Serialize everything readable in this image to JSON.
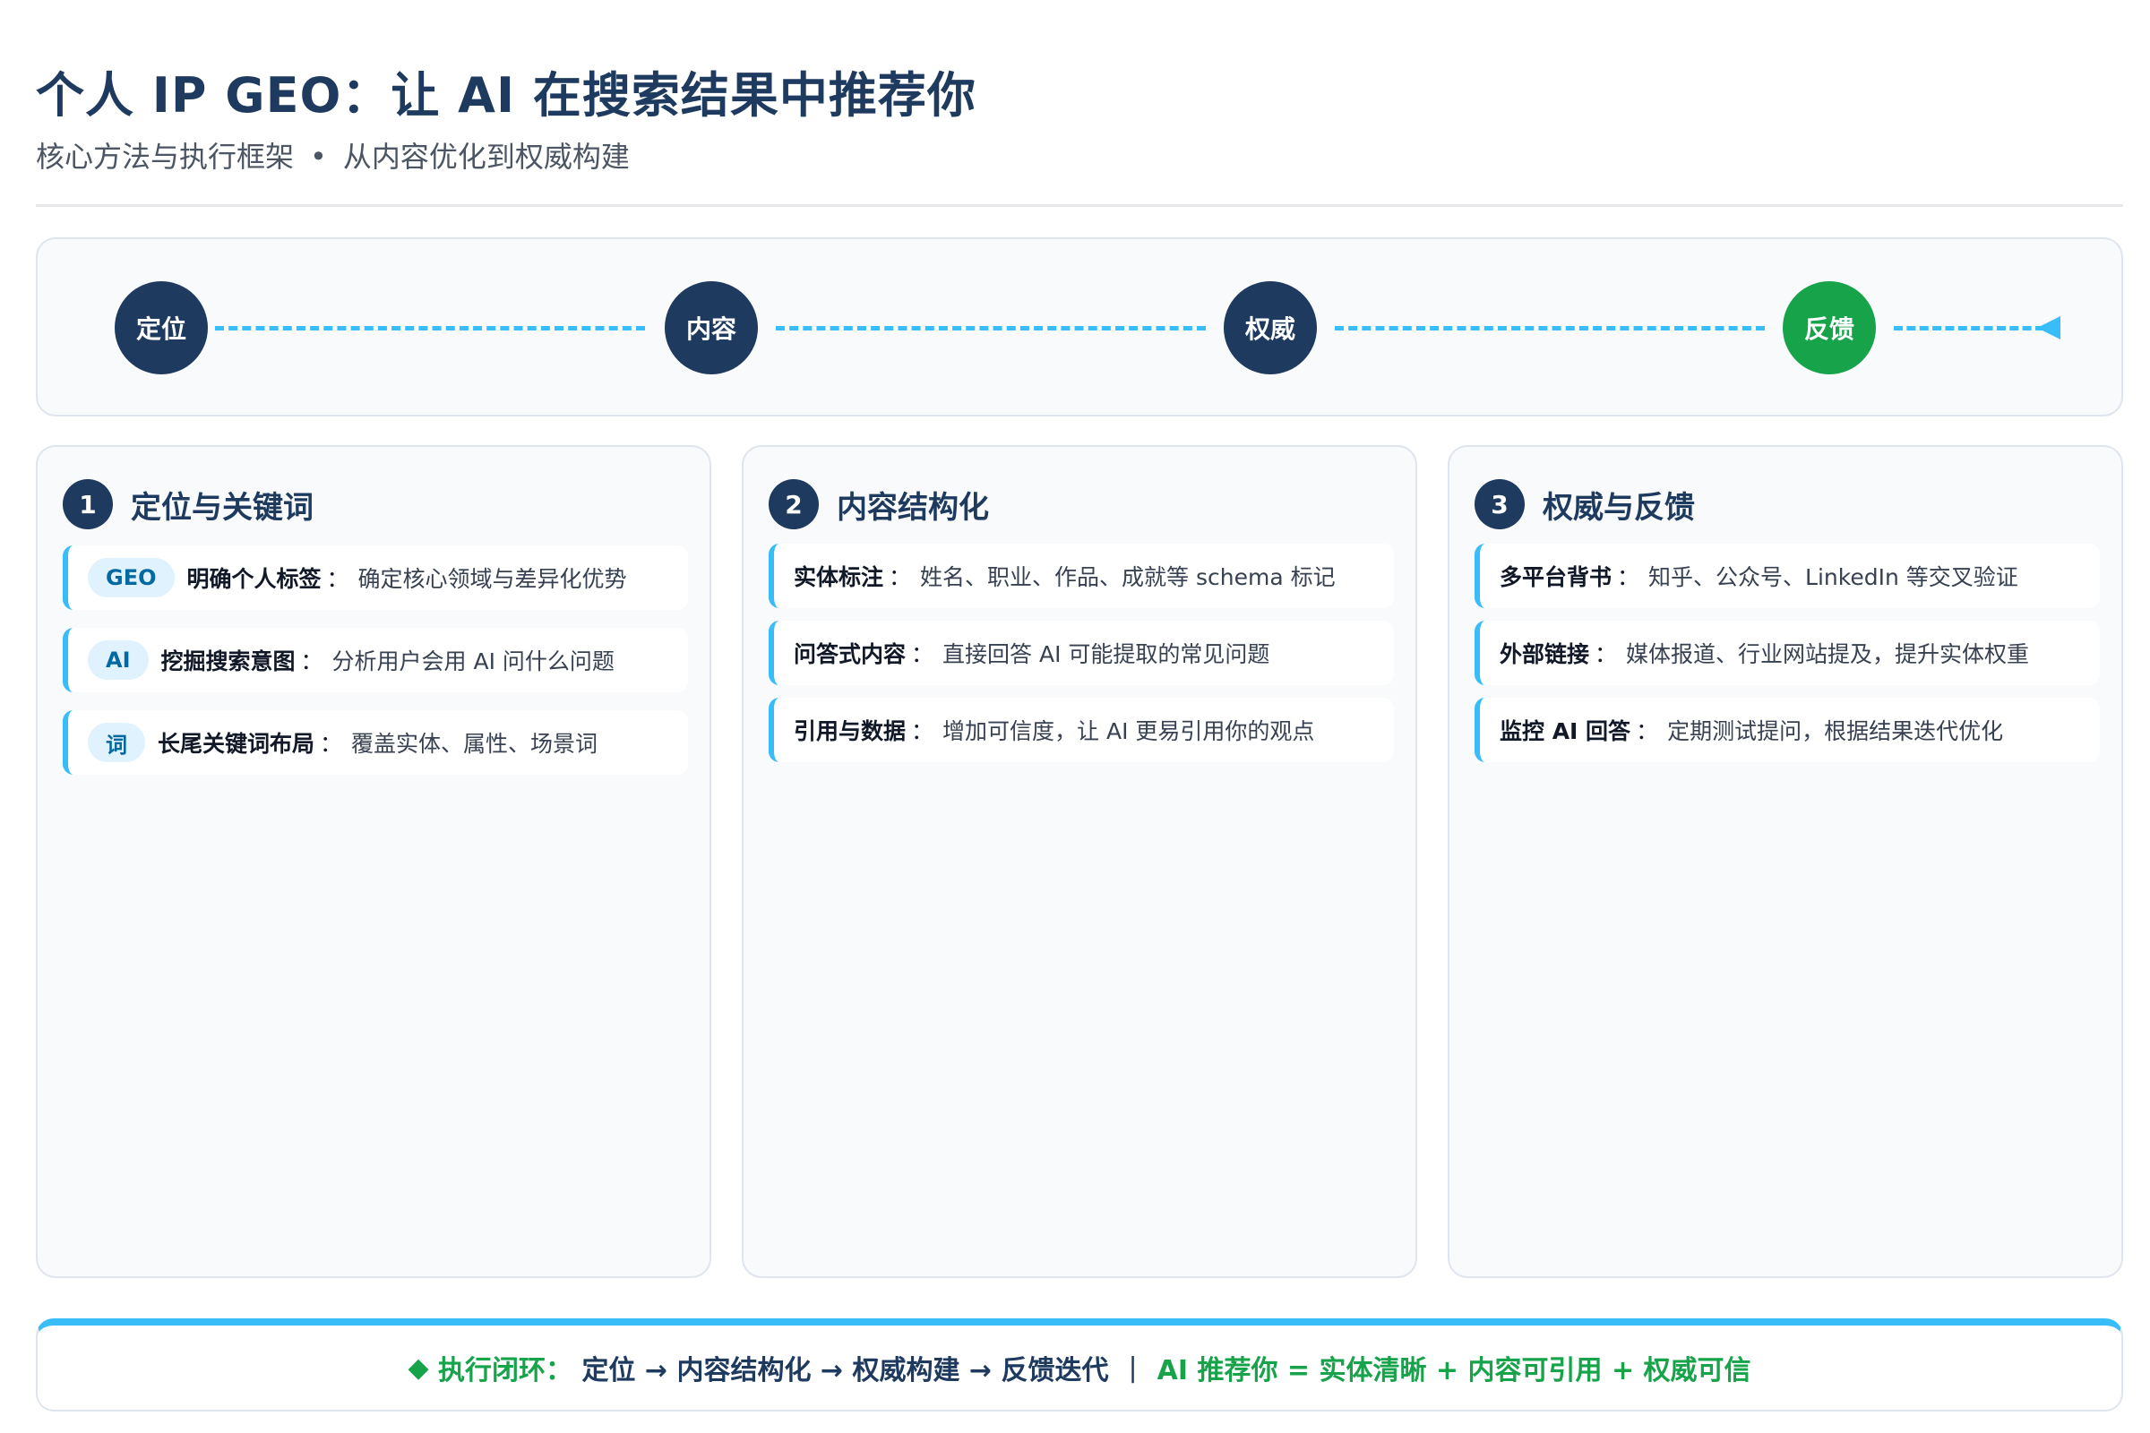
{
  "header": {
    "title": "个人 IP GEO：让 AI 在搜索结果中推荐你",
    "subtitle_left": "核心方法与执行框架",
    "subtitle_dot": "•",
    "subtitle_right": "从内容优化到权威构建"
  },
  "flow": {
    "steps": [
      "定位",
      "内容",
      "权威",
      "反馈"
    ],
    "colors": {
      "step": "#1e3a5f",
      "final": "#16a34a",
      "connector": "#38bdf8"
    }
  },
  "columns": [
    {
      "number": "1",
      "title": "定位与关键词",
      "items": [
        {
          "tag": "GEO",
          "label": "明确个人标签",
          "sep": "：",
          "desc": "确定核心领域与差异化优势"
        },
        {
          "tag": "AI",
          "label": "挖掘搜索意图",
          "sep": "：",
          "desc": "分析用户会用 AI 问什么问题"
        },
        {
          "tag": "词",
          "label": "长尾关键词布局",
          "sep": "：",
          "desc": "覆盖实体、属性、场景词"
        }
      ]
    },
    {
      "number": "2",
      "title": "内容结构化",
      "items": [
        {
          "label": "实体标注",
          "sep": "：",
          "desc": "姓名、职业、作品、成就等 schema 标记"
        },
        {
          "label": "问答式内容",
          "sep": "：",
          "desc": "直接回答 AI 可能提取的常见问题"
        },
        {
          "label": "引用与数据",
          "sep": "：",
          "desc": "增加可信度，让 AI 更易引用你的观点"
        }
      ]
    },
    {
      "number": "3",
      "title": "权威与反馈",
      "items": [
        {
          "label": "多平台背书",
          "sep": "：",
          "desc": "知乎、公众号、LinkedIn 等交叉验证"
        },
        {
          "label": "外部链接",
          "sep": "：",
          "desc": "媒体报道、行业网站提及，提升实体权重"
        },
        {
          "label": "监控 AI 回答",
          "sep": "：",
          "desc": "定期测试提问，根据结果迭代优化"
        }
      ]
    }
  ],
  "footer": {
    "icon": "◆",
    "lead": "执行闭环：",
    "loop": "定位 → 内容结构化 → 权威构建 → 反馈迭代",
    "divider": "|",
    "formula": "AI 推荐你 = 实体清晰 + 内容可引用 + 权威可信"
  }
}
